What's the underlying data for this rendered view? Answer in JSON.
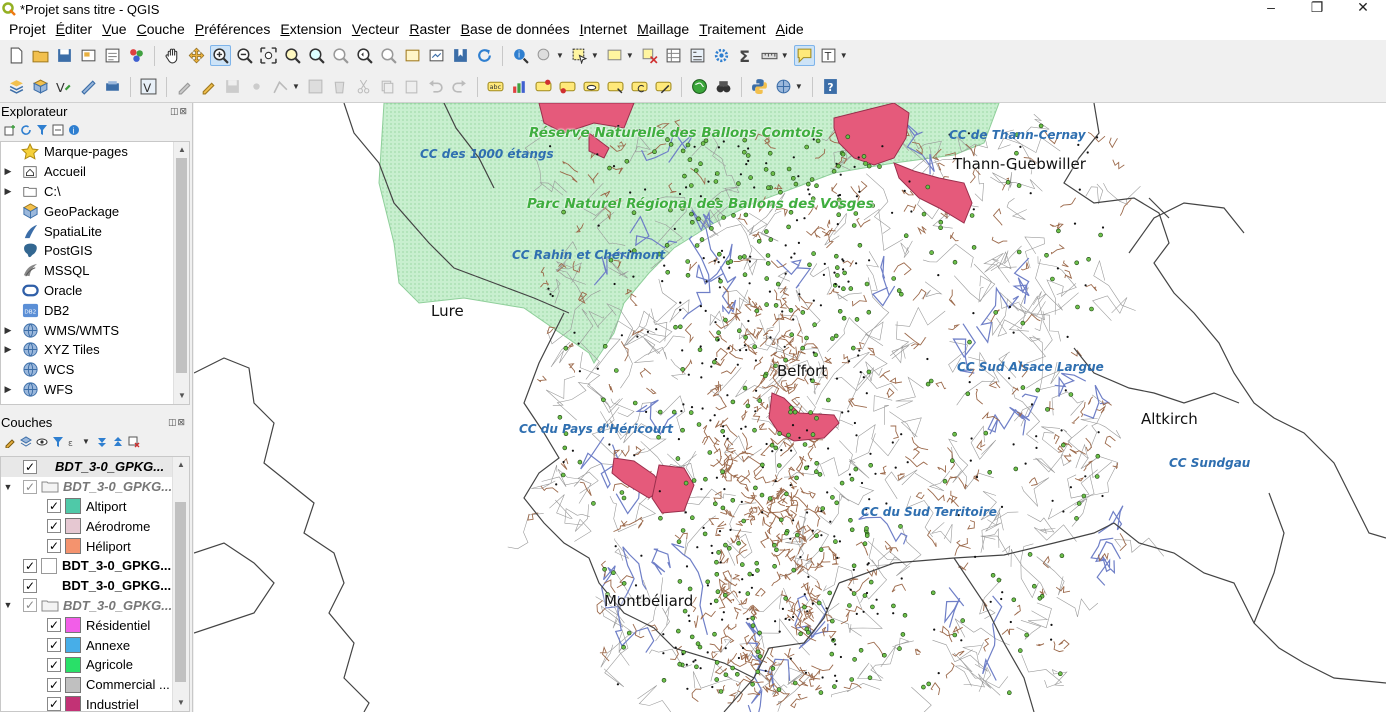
{
  "window": {
    "title": "*Projet sans titre - QGIS",
    "controls": [
      "–",
      "❐",
      "✕"
    ]
  },
  "menu": [
    {
      "text": "Projet",
      "u": ""
    },
    {
      "text": "diter",
      "u": "É"
    },
    {
      "text": "ue",
      "u": "V",
      "prefix": ""
    },
    {
      "text": "ouche",
      "u": "C"
    },
    {
      "text": "références",
      "u": "P"
    },
    {
      "text": "xtension",
      "u": "E"
    },
    {
      "text": "ecteur",
      "u": "V"
    },
    {
      "text": "aster",
      "u": "R"
    },
    {
      "text": "ase de données",
      "u": "B"
    },
    {
      "text": "nternet",
      "u": "I"
    },
    {
      "text": "aillage",
      "u": "M"
    },
    {
      "text": "raitement",
      "u": "T"
    },
    {
      "text": "ide",
      "u": "A"
    }
  ],
  "browser_panel": {
    "title": "Explorateur",
    "items": [
      {
        "label": "Marque-pages",
        "icon": "star-icon",
        "expand": false
      },
      {
        "label": "Accueil",
        "icon": "home-folder-icon",
        "expand": true
      },
      {
        "label": "C:\\",
        "icon": "drive-icon",
        "expand": true
      },
      {
        "label": "GeoPackage",
        "icon": "geopackage-icon",
        "expand": false
      },
      {
        "label": "SpatiaLite",
        "icon": "spatialite-icon",
        "expand": false
      },
      {
        "label": "PostGIS",
        "icon": "postgis-icon",
        "expand": false
      },
      {
        "label": "MSSQL",
        "icon": "mssql-icon",
        "expand": false
      },
      {
        "label": "Oracle",
        "icon": "oracle-icon",
        "expand": false
      },
      {
        "label": "DB2",
        "icon": "db2-icon",
        "expand": false
      },
      {
        "label": "WMS/WMTS",
        "icon": "globe-icon",
        "expand": true
      },
      {
        "label": "XYZ Tiles",
        "icon": "globe-icon",
        "expand": true
      },
      {
        "label": "WCS",
        "icon": "globe-icon",
        "expand": false
      },
      {
        "label": "WFS",
        "icon": "globe-icon",
        "expand": true
      }
    ]
  },
  "layers_panel": {
    "title": "Couches",
    "items": [
      {
        "label": "BDT_3-0_GPKG...",
        "type": "layer",
        "checked": true,
        "style": "bold-italic",
        "selected": true
      },
      {
        "label": "BDT_3-0_GPKG...",
        "type": "group",
        "checked": true,
        "style": "grey"
      },
      {
        "label": "Altiport",
        "type": "class",
        "checked": true,
        "color": "#4fc9a8"
      },
      {
        "label": "Aérodrome",
        "type": "class",
        "checked": true,
        "color": "#e6c8d2"
      },
      {
        "label": "Héliport",
        "type": "class",
        "checked": true,
        "color": "#f4936e"
      },
      {
        "label": "BDT_3-0_GPKG...",
        "type": "layer",
        "checked": true,
        "style": "bold",
        "swatch": "#ffffff"
      },
      {
        "label": "BDT_3-0_GPKG...",
        "type": "layer",
        "checked": true,
        "style": "bold"
      },
      {
        "label": "BDT_3-0_GPKG...",
        "type": "group",
        "checked": true,
        "style": "grey"
      },
      {
        "label": "Résidentiel",
        "type": "class",
        "checked": true,
        "color": "#f25ee8"
      },
      {
        "label": "Annexe",
        "type": "class",
        "checked": true,
        "color": "#47aee8"
      },
      {
        "label": "Agricole",
        "type": "class",
        "checked": true,
        "color": "#29e068"
      },
      {
        "label": "Commercial ...",
        "type": "class",
        "checked": true,
        "color": "#c0c0c0"
      },
      {
        "label": "Industriel",
        "type": "class",
        "checked": true,
        "color": "#c23275"
      }
    ]
  },
  "map": {
    "labels_cc": [
      "CC des 1000 étangs",
      "CC de Thann-Cernay",
      "CC Rahin et Chérimont",
      "CC Sud Alsace Largue",
      "CC du Pays d'Héricourt",
      "CC Sundgau",
      "CC du Sud Territoire"
    ],
    "labels_green": [
      "Réserve Naturelle des Ballons Comtois",
      "Parc Naturel Régional des Ballons des Vosges"
    ],
    "labels_city": [
      "Thann-Guebwiller",
      "Lure",
      "Belfort",
      "Altkirch",
      "Montbéliard"
    ],
    "colors": {
      "park": "#c8efcf",
      "reserve": "#e55a7b",
      "roads": "#9c6a4c",
      "rivers": "#6f7fc7",
      "boundaries": "#444444"
    }
  }
}
